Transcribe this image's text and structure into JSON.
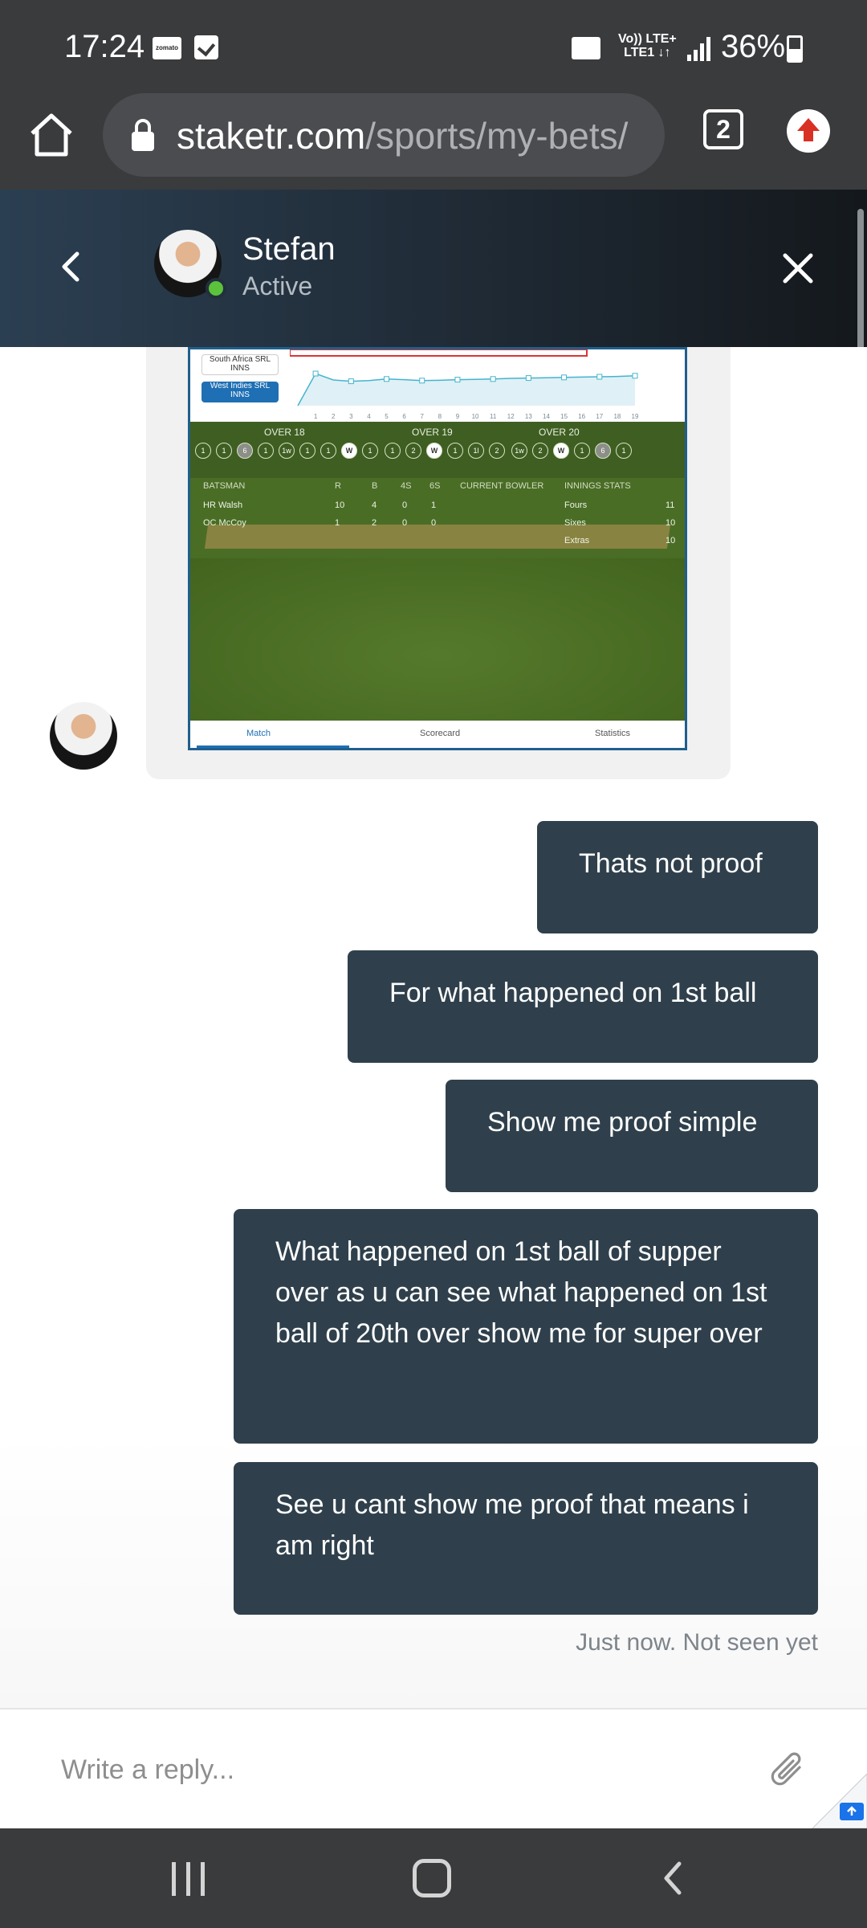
{
  "status_bar": {
    "time": "17:24",
    "app_badge": "zomato",
    "network_top": "Vo)) LTE+",
    "network_bottom": "LTE1 ↓↑",
    "battery": "36%"
  },
  "browser": {
    "url_domain": "staketr.com",
    "url_path": "/sports/my-bets/",
    "tab_count": "2"
  },
  "chat_header": {
    "contact_name": "Stefan",
    "contact_status": "Active",
    "online_color": "#5cc23c"
  },
  "screenshot": {
    "team_a": "South Africa SRL INNS",
    "team_b": "West Indies SRL INNS",
    "graph_ticks": [
      "1",
      "2",
      "3",
      "4",
      "5",
      "6",
      "7",
      "8",
      "9",
      "10",
      "11",
      "12",
      "13",
      "14",
      "15",
      "16",
      "17",
      "18",
      "19"
    ],
    "graph_values": [
      0,
      10,
      8,
      7.6,
      7.8,
      8.3,
      8.1,
      7.8,
      7.9,
      8.1,
      8.2,
      8.3,
      8.5,
      8.6,
      8.7,
      8.8,
      8.9,
      9,
      9.1,
      9.3
    ],
    "overs": [
      {
        "label": "OVER 18",
        "balls": [
          "6",
          "1",
          "1w",
          "1",
          "1",
          "W",
          "1"
        ]
      },
      {
        "label": "OVER 19",
        "balls": [
          "1",
          "2",
          "W",
          "1",
          "1l",
          "2"
        ]
      },
      {
        "label": "OVER 20",
        "balls": [
          "1w",
          "2",
          "W",
          "1",
          "6",
          "1"
        ]
      }
    ],
    "leading_balls": [
      "1",
      "1"
    ],
    "stats_headers": {
      "batsman": "BATSMAN",
      "r": "R",
      "b": "B",
      "fours": "4S",
      "sixes": "6S",
      "bowler": "CURRENT BOWLER",
      "innings": "INNINGS STATS"
    },
    "batsmen": [
      {
        "name": "HR Walsh",
        "r": "10",
        "b": "4",
        "fours": "0",
        "sixes": "1"
      },
      {
        "name": "OC McCoy",
        "r": "1",
        "b": "2",
        "fours": "0",
        "sixes": "0"
      }
    ],
    "innings_stats": [
      {
        "label": "Fours",
        "value": "11"
      },
      {
        "label": "Sixes",
        "value": "10"
      },
      {
        "label": "Extras",
        "value": "10"
      }
    ],
    "tabs": [
      "Match",
      "Scorecard",
      "Statistics"
    ]
  },
  "messages": [
    {
      "text": "Thats not proof"
    },
    {
      "text": "For what happened on 1st ball"
    },
    {
      "text": "Show me proof simple"
    },
    {
      "text": "What happened on 1st ball of supper over as u can see what happened on 1st ball of 20th over show me for super over"
    },
    {
      "text": "See u cant show me proof that means i am right"
    }
  ],
  "message_meta": "Just now. Not seen yet",
  "composer": {
    "placeholder": "Write a reply..."
  }
}
